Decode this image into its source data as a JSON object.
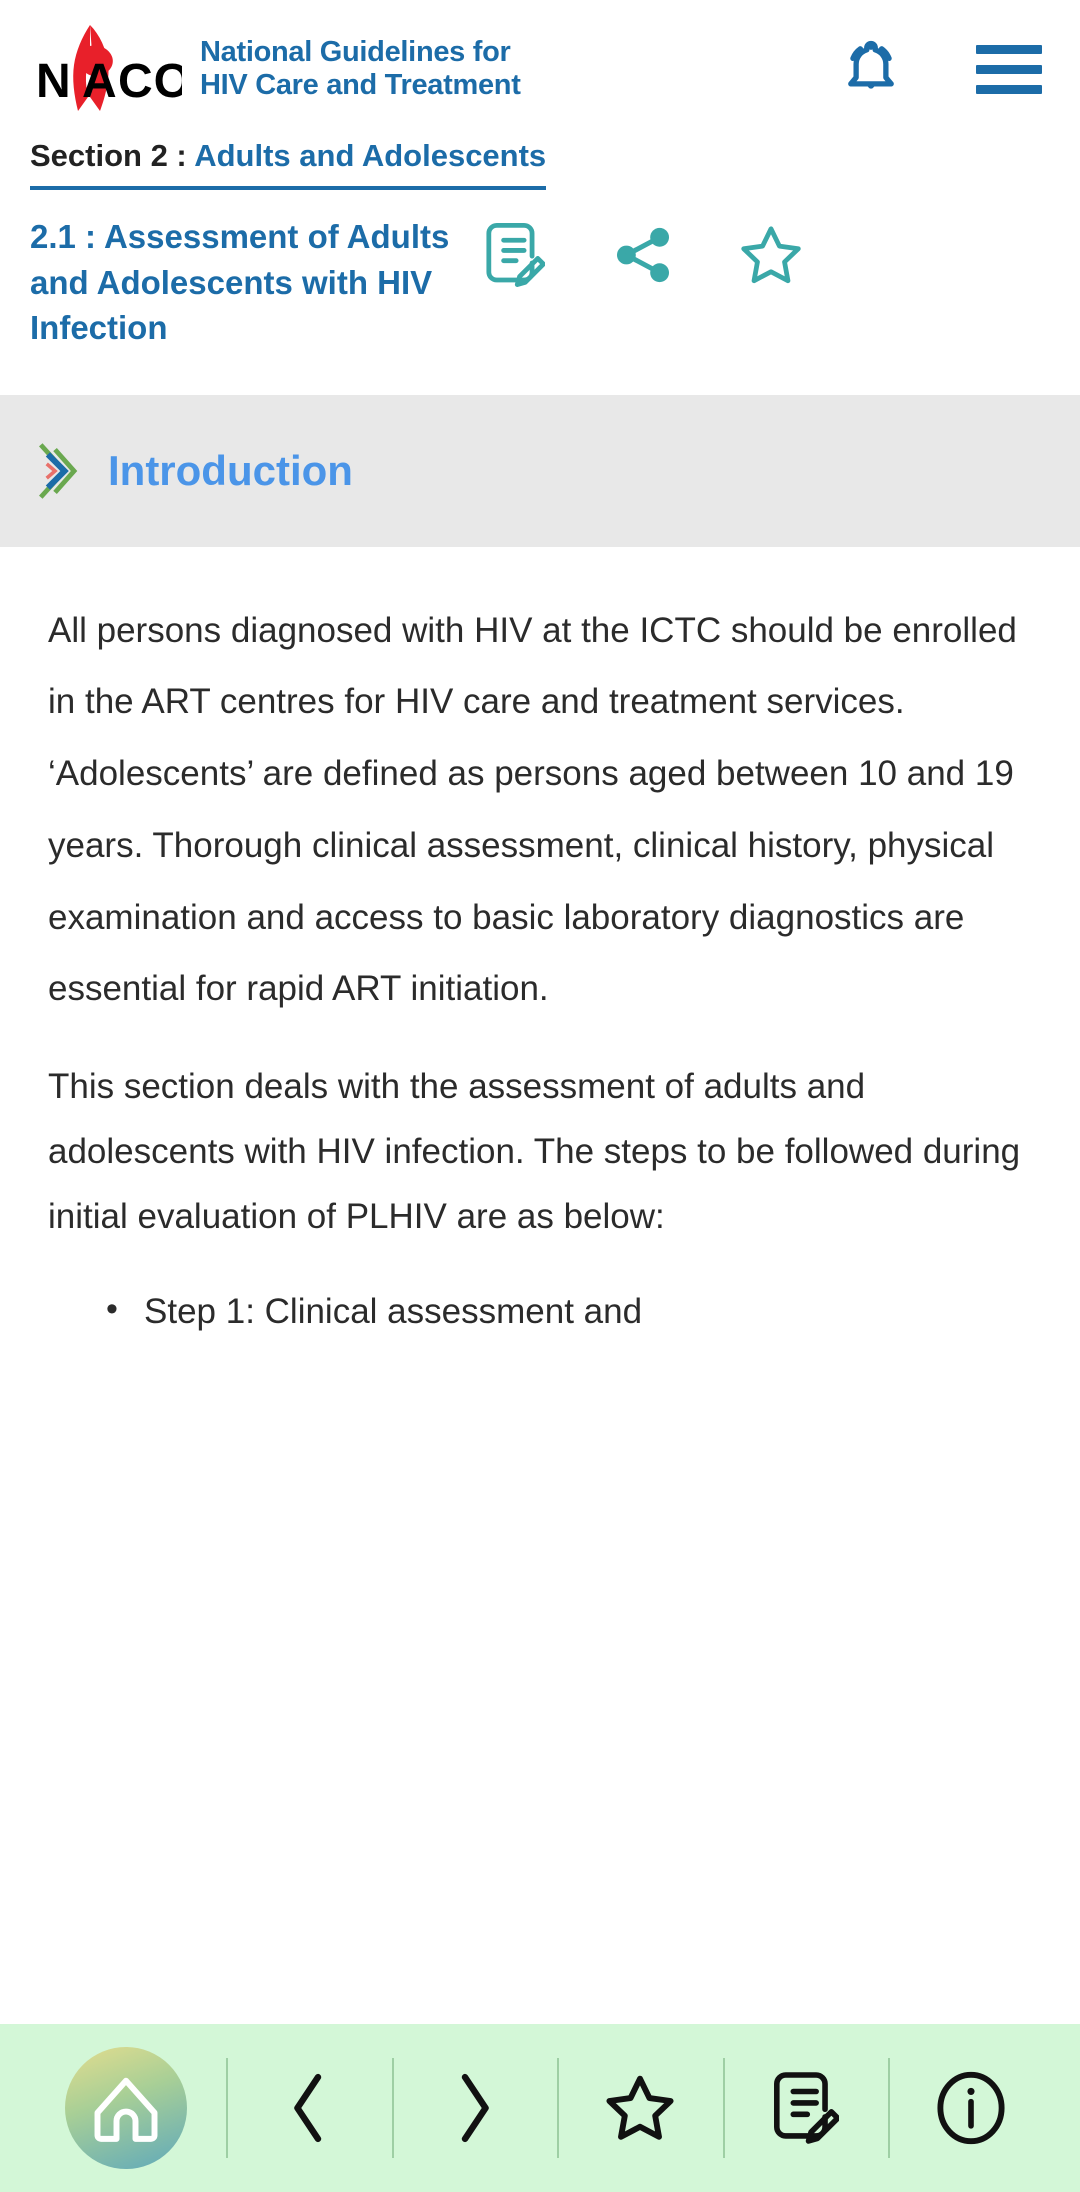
{
  "header": {
    "logo_alt": "NACO",
    "logo_text": "NACO",
    "title_line1": "National Guidelines for",
    "title_line2": "HIV Care and Treatment",
    "notification_icon": "bell-icon",
    "menu_icon": "hamburger-menu-icon",
    "brand_color": "#1c6ca8",
    "ribbon_color": "#e8202a"
  },
  "breadcrumb": {
    "section_label": "Section 2 : ",
    "section_name": "Adults and Adolescents"
  },
  "chapter": {
    "title": "2.1 : Assessment of Adults and Adolescents with HIV Infection",
    "actions": [
      {
        "name": "note-edit-icon",
        "label": "Notes"
      },
      {
        "name": "share-icon",
        "label": "Share"
      },
      {
        "name": "star-outline-icon",
        "label": "Bookmark"
      }
    ],
    "action_color": "#3aa8a8"
  },
  "intro": {
    "icon": "double-chevron-right-icon",
    "label": "Introduction",
    "label_color": "#4b95e8",
    "background_color": "#e8e8e8"
  },
  "body": {
    "paragraphs": [
      "All persons diagnosed with HIV at the ICTC should be enrolled in the ART centres for HIV care and treatment services. ‘Adolescents’ are defined as persons aged between 10 and 19 years. Thorough clinical assessment, clinical history, physical examination and access to basic laboratory diagnostics are essential for rapid ART initiation.",
      "This section deals with the assessment of adults and adolescents with HIV infection. The steps to be followed during initial evaluation of PLHIV are as below:"
    ],
    "bullets": [
      "Step 1: Clinical assessment and"
    ]
  },
  "bottom_nav": {
    "background_color": "#d3f7d7",
    "items": [
      {
        "name": "home-icon",
        "label": "Home"
      },
      {
        "name": "chevron-left-icon",
        "label": "Previous"
      },
      {
        "name": "chevron-right-icon",
        "label": "Next"
      },
      {
        "name": "star-outline-icon",
        "label": "Bookmarks"
      },
      {
        "name": "note-edit-icon",
        "label": "Notes"
      },
      {
        "name": "info-circle-icon",
        "label": "Info"
      }
    ]
  }
}
